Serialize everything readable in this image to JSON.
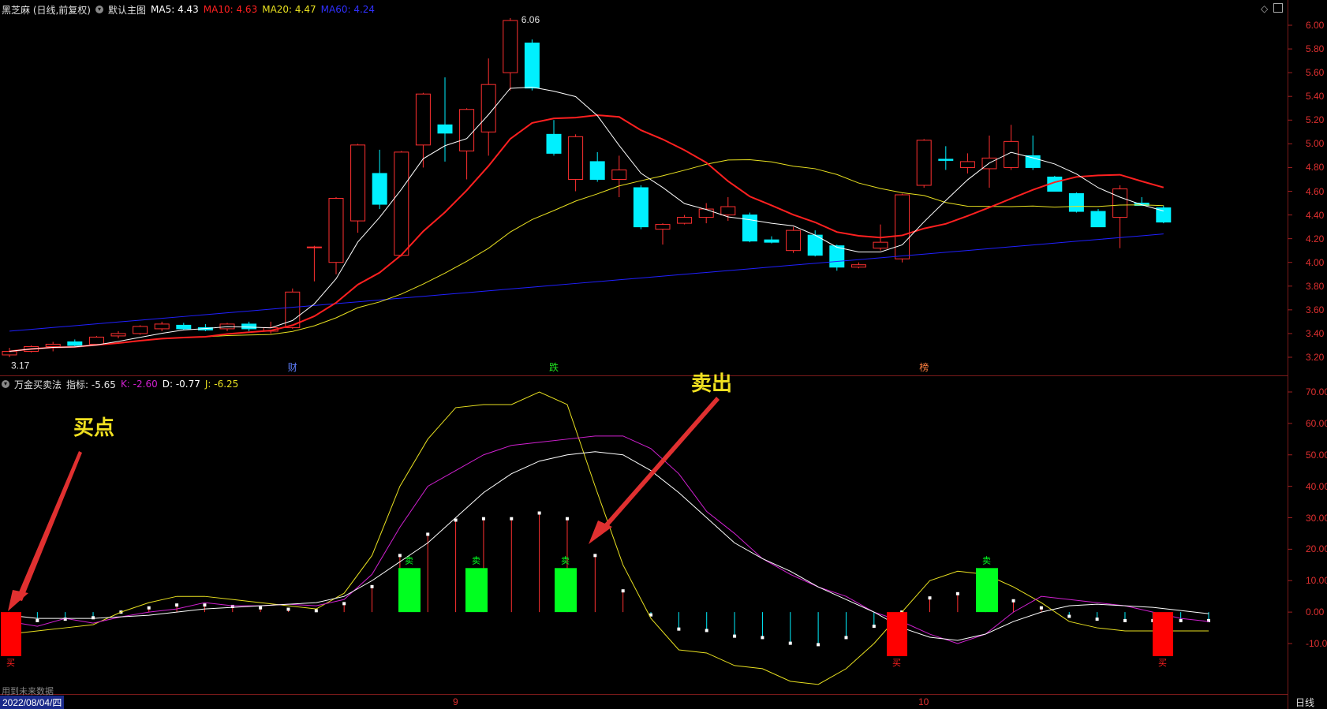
{
  "main_panel": {
    "title": "黑芝麻 (日线,前复权)",
    "template": "默认主图",
    "ma5": "MA5: 4.43",
    "ma10": "MA10: 4.63",
    "ma20": "MA20: 4.47",
    "ma60": "MA60: 4.24",
    "high_label": "6.06",
    "low_label": "3.17",
    "yaxis": [
      "6.00",
      "5.80",
      "5.60",
      "5.40",
      "5.20",
      "5.00",
      "4.80",
      "4.60",
      "4.40",
      "4.20",
      "4.00",
      "3.80",
      "3.60",
      "3.40",
      "3.20"
    ],
    "markers": [
      "财",
      "跌",
      "榜"
    ]
  },
  "sub_panel": {
    "name": "万金买卖法",
    "index": "指标: -5.65",
    "k": "K: -2.60",
    "d": "D: -0.77",
    "j": "J: -6.25",
    "yaxis": [
      "70.00",
      "60.00",
      "50.00",
      "40.00",
      "30.00",
      "20.00",
      "10.00",
      "0.00",
      "-10.00"
    ],
    "sell_labels": [
      "卖",
      "卖",
      "卖",
      "卖"
    ],
    "buy_labels": [
      "买",
      "买",
      "买"
    ]
  },
  "annotations": {
    "buy": "买点",
    "sell": "卖出"
  },
  "footer": {
    "note": "用到未来数据",
    "date": "2022/08/04/四",
    "month1": "9",
    "month2": "10",
    "period": "日线"
  },
  "colors": {
    "up": "#ff3030",
    "down": "#00f0ff",
    "ma5": "#ffffff",
    "ma10": "#ff2020",
    "ma20": "#e8e020",
    "ma60": "#2020ff",
    "k": "#d020d0",
    "d": "#ffffff",
    "j": "#e8e020"
  },
  "chart_data": {
    "type": "candlestick",
    "ohlc": [
      [
        3.22,
        3.28,
        3.2,
        3.25
      ],
      [
        3.25,
        3.3,
        3.24,
        3.29
      ],
      [
        3.29,
        3.33,
        3.25,
        3.31
      ],
      [
        3.33,
        3.35,
        3.29,
        3.3
      ],
      [
        3.31,
        3.38,
        3.3,
        3.37
      ],
      [
        3.38,
        3.42,
        3.36,
        3.4
      ],
      [
        3.4,
        3.47,
        3.39,
        3.46
      ],
      [
        3.44,
        3.5,
        3.42,
        3.48
      ],
      [
        3.47,
        3.49,
        3.43,
        3.44
      ],
      [
        3.45,
        3.48,
        3.42,
        3.43
      ],
      [
        3.44,
        3.49,
        3.42,
        3.48
      ],
      [
        3.48,
        3.5,
        3.42,
        3.44
      ],
      [
        3.42,
        3.5,
        3.4,
        3.45
      ],
      [
        3.45,
        3.78,
        3.44,
        3.75
      ],
      [
        4.13,
        4.14,
        3.84,
        4.13
      ],
      [
        4.0,
        4.55,
        3.9,
        4.54
      ],
      [
        4.35,
        5.0,
        4.25,
        4.99
      ],
      [
        4.75,
        4.95,
        4.45,
        4.49
      ],
      [
        4.06,
        4.94,
        4.05,
        4.93
      ],
      [
        4.99,
        5.43,
        4.8,
        5.42
      ],
      [
        5.16,
        5.56,
        4.85,
        5.09
      ],
      [
        4.94,
        5.3,
        4.7,
        5.29
      ],
      [
        5.1,
        5.72,
        4.9,
        5.5
      ],
      [
        5.6,
        6.06,
        5.45,
        6.04
      ],
      [
        5.85,
        5.88,
        5.45,
        5.47
      ],
      [
        5.08,
        5.2,
        4.9,
        4.92
      ],
      [
        4.7,
        5.08,
        4.6,
        5.06
      ],
      [
        4.85,
        4.93,
        4.68,
        4.7
      ],
      [
        4.7,
        4.9,
        4.55,
        4.78
      ],
      [
        4.63,
        4.65,
        4.28,
        4.3
      ],
      [
        4.28,
        4.33,
        4.15,
        4.32
      ],
      [
        4.33,
        4.4,
        4.32,
        4.38
      ],
      [
        4.38,
        4.5,
        4.33,
        4.45
      ],
      [
        4.4,
        4.55,
        4.35,
        4.47
      ],
      [
        4.4,
        4.42,
        4.17,
        4.18
      ],
      [
        4.19,
        4.22,
        4.16,
        4.17
      ],
      [
        4.1,
        4.3,
        4.08,
        4.27
      ],
      [
        4.23,
        4.27,
        4.05,
        4.06
      ],
      [
        4.14,
        4.15,
        3.93,
        3.96
      ],
      [
        3.96,
        4.0,
        3.95,
        3.98
      ],
      [
        4.12,
        4.32,
        4.1,
        4.17
      ],
      [
        4.03,
        4.58,
        4.0,
        4.57
      ],
      [
        4.65,
        5.04,
        4.63,
        5.03
      ],
      [
        4.87,
        4.98,
        4.78,
        4.86
      ],
      [
        4.8,
        4.92,
        4.75,
        4.85
      ],
      [
        4.79,
        5.07,
        4.63,
        4.88
      ],
      [
        4.8,
        5.16,
        4.78,
        5.02
      ],
      [
        4.9,
        5.07,
        4.78,
        4.8
      ],
      [
        4.72,
        4.73,
        4.6,
        4.6
      ],
      [
        4.58,
        4.59,
        4.42,
        4.43
      ],
      [
        4.43,
        4.45,
        4.3,
        4.3
      ],
      [
        4.38,
        4.65,
        4.12,
        4.62
      ],
      [
        4.5,
        4.55,
        4.48,
        4.48
      ],
      [
        4.46,
        4.48,
        4.33,
        4.34
      ]
    ],
    "kdj": {
      "k": [
        -3,
        -4.5,
        -2,
        -3.5,
        -1.5,
        0,
        1,
        3,
        2,
        2,
        2.5,
        2,
        4,
        12,
        27,
        40,
        45,
        50,
        53,
        54,
        55,
        56,
        56,
        52,
        44,
        32,
        25,
        17,
        12,
        8,
        5,
        0,
        -3,
        -7,
        -10,
        -7,
        0,
        5,
        4,
        3,
        2,
        0,
        -2,
        -3
      ],
      "d": [
        -1,
        -2,
        -2,
        -2,
        -1.5,
        -1,
        0,
        1,
        1.5,
        2,
        2.5,
        3,
        5,
        10,
        16,
        22,
        30,
        38,
        44,
        48,
        50,
        51,
        50,
        45,
        38,
        30,
        22,
        17,
        13,
        8,
        4,
        0,
        -5,
        -8,
        -9,
        -7,
        -3,
        0,
        2,
        2.5,
        2,
        1.5,
        0.5,
        -0.5
      ],
      "j": [
        -7,
        -6,
        -5,
        -4,
        0,
        3,
        5,
        5,
        4,
        3,
        2,
        1,
        6,
        18,
        40,
        55,
        65,
        66,
        66,
        70,
        66,
        40,
        15,
        -2,
        -12,
        -13,
        -17,
        -18,
        -22,
        -23,
        -18,
        -10,
        0,
        10,
        13,
        12,
        8,
        3,
        -3,
        -5,
        -6,
        -6,
        -6,
        -6
      ]
    }
  }
}
